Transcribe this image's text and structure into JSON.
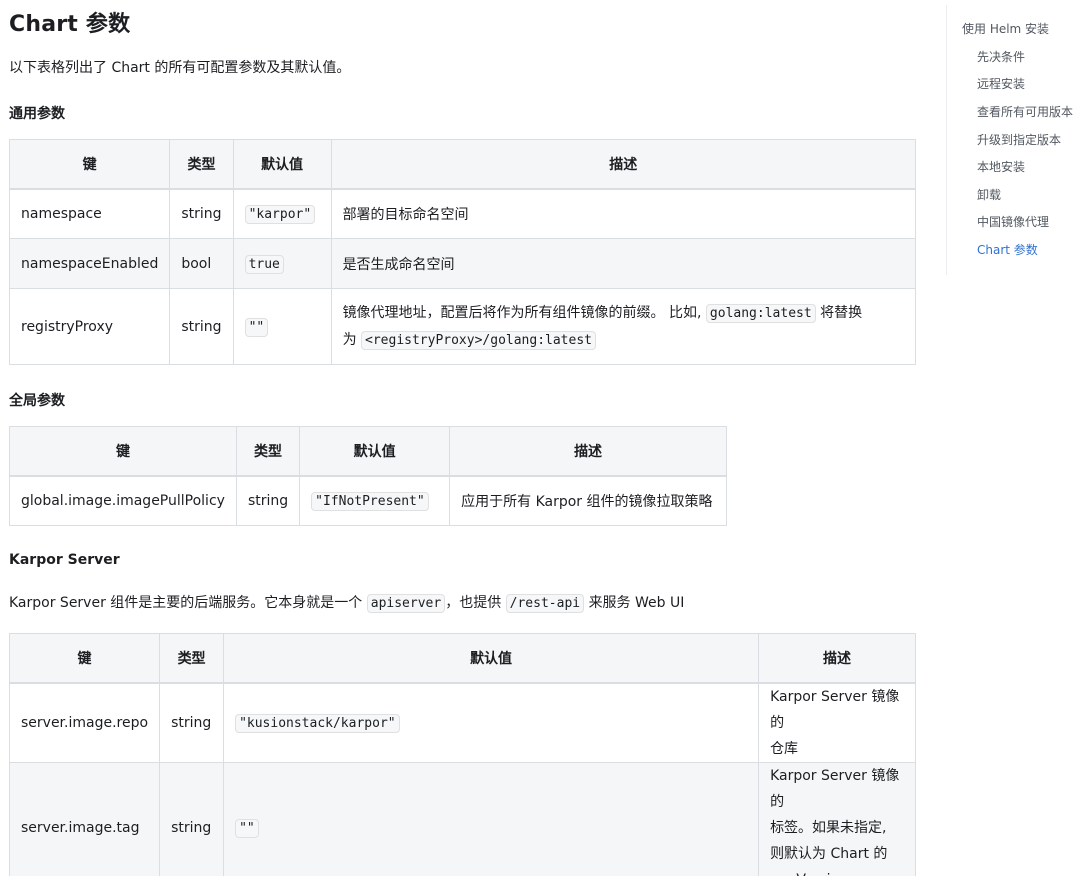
{
  "page": {
    "title": "Chart 参数",
    "intro": "以下表格列出了 Chart 的所有可配置参数及其默认值。"
  },
  "sections": {
    "common": {
      "title": "通用参数",
      "headers": [
        "键",
        "类型",
        "默认值",
        "描述"
      ],
      "rows": [
        {
          "key": "namespace",
          "type": "string",
          "default": "\"karpor\"",
          "desc": "部署的目标命名空间"
        },
        {
          "key": "namespaceEnabled",
          "type": "bool",
          "default": "true",
          "desc": "是否生成命名空间"
        },
        {
          "key": "registryProxy",
          "type": "string",
          "default": "\"\"",
          "desc_a": "镜像代理地址，配置后将作为所有组件镜像的前缀。 比如,",
          "desc_code1": "golang:latest",
          "desc_b": "将替换",
          "desc_c": "为",
          "desc_code2": "<registryProxy>/golang:latest"
        }
      ]
    },
    "global": {
      "title": "全局参数",
      "headers": [
        "键",
        "类型",
        "默认值",
        "描述"
      ],
      "rows": [
        {
          "key": "global.image.imagePullPolicy",
          "type": "string",
          "default": "\"IfNotPresent\"",
          "desc": "应用于所有 Karpor 组件的镜像拉取策略"
        }
      ]
    },
    "server": {
      "title": "Karpor Server",
      "intro_a": "Karpor Server 组件是主要的后端服务。它本身就是一个",
      "intro_code1": "apiserver",
      "intro_b": "，也提供",
      "intro_code2": "/rest-api",
      "intro_c": "来服务 Web UI",
      "headers": [
        "键",
        "类型",
        "默认值",
        "描述"
      ],
      "rows": [
        {
          "key": "server.image.repo",
          "type": "string",
          "default": "\"kusionstack/karpor\"",
          "desc_lines": [
            "Karpor Server 镜像的",
            "仓库"
          ]
        },
        {
          "key": "server.image.tag",
          "type": "string",
          "default": "\"\"",
          "desc_lines": [
            "Karpor Server 镜像的",
            "标签。如果未指定,",
            "则默认为 Chart 的",
            "appVersion"
          ]
        }
      ]
    }
  },
  "toc": {
    "items": [
      "使用 Helm 安装",
      "先决条件",
      "远程安装",
      "查看所有可用版本",
      "升级到指定版本",
      "本地安装",
      "卸载",
      "中国镜像代理",
      "Chart 参数"
    ],
    "active_index": 8,
    "active_color": "#2e72d2"
  }
}
